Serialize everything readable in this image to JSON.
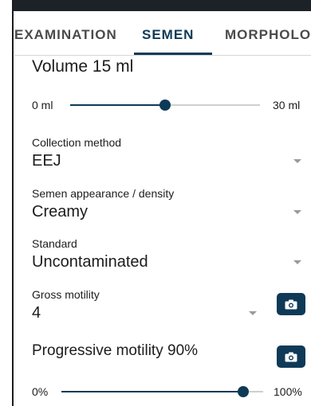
{
  "tabs": [
    {
      "label": "EXAMINATION",
      "active": false
    },
    {
      "label": "SEMEN",
      "active": true
    },
    {
      "label": "MORPHOLOG",
      "active": false
    }
  ],
  "volume": {
    "label": "Volume",
    "value_text": "15 ml",
    "min_label": "0 ml",
    "max_label": "30 ml",
    "value": 15,
    "min": 0,
    "max": 30
  },
  "collection_method": {
    "label": "Collection method",
    "value": "EEJ"
  },
  "appearance": {
    "label": "Semen appearance / density",
    "value": "Creamy"
  },
  "standard": {
    "label": "Standard",
    "value": "Uncontaminated"
  },
  "gross_motility": {
    "label": "Gross motility",
    "value": "4"
  },
  "progressive_motility": {
    "label": "Progressive motility",
    "value_text": "90%",
    "min_label": "0%",
    "max_label": "100%",
    "value": 90,
    "min": 0,
    "max": 100
  },
  "colors": {
    "accent": "#0e3a57",
    "track": "#cfcfcf"
  }
}
